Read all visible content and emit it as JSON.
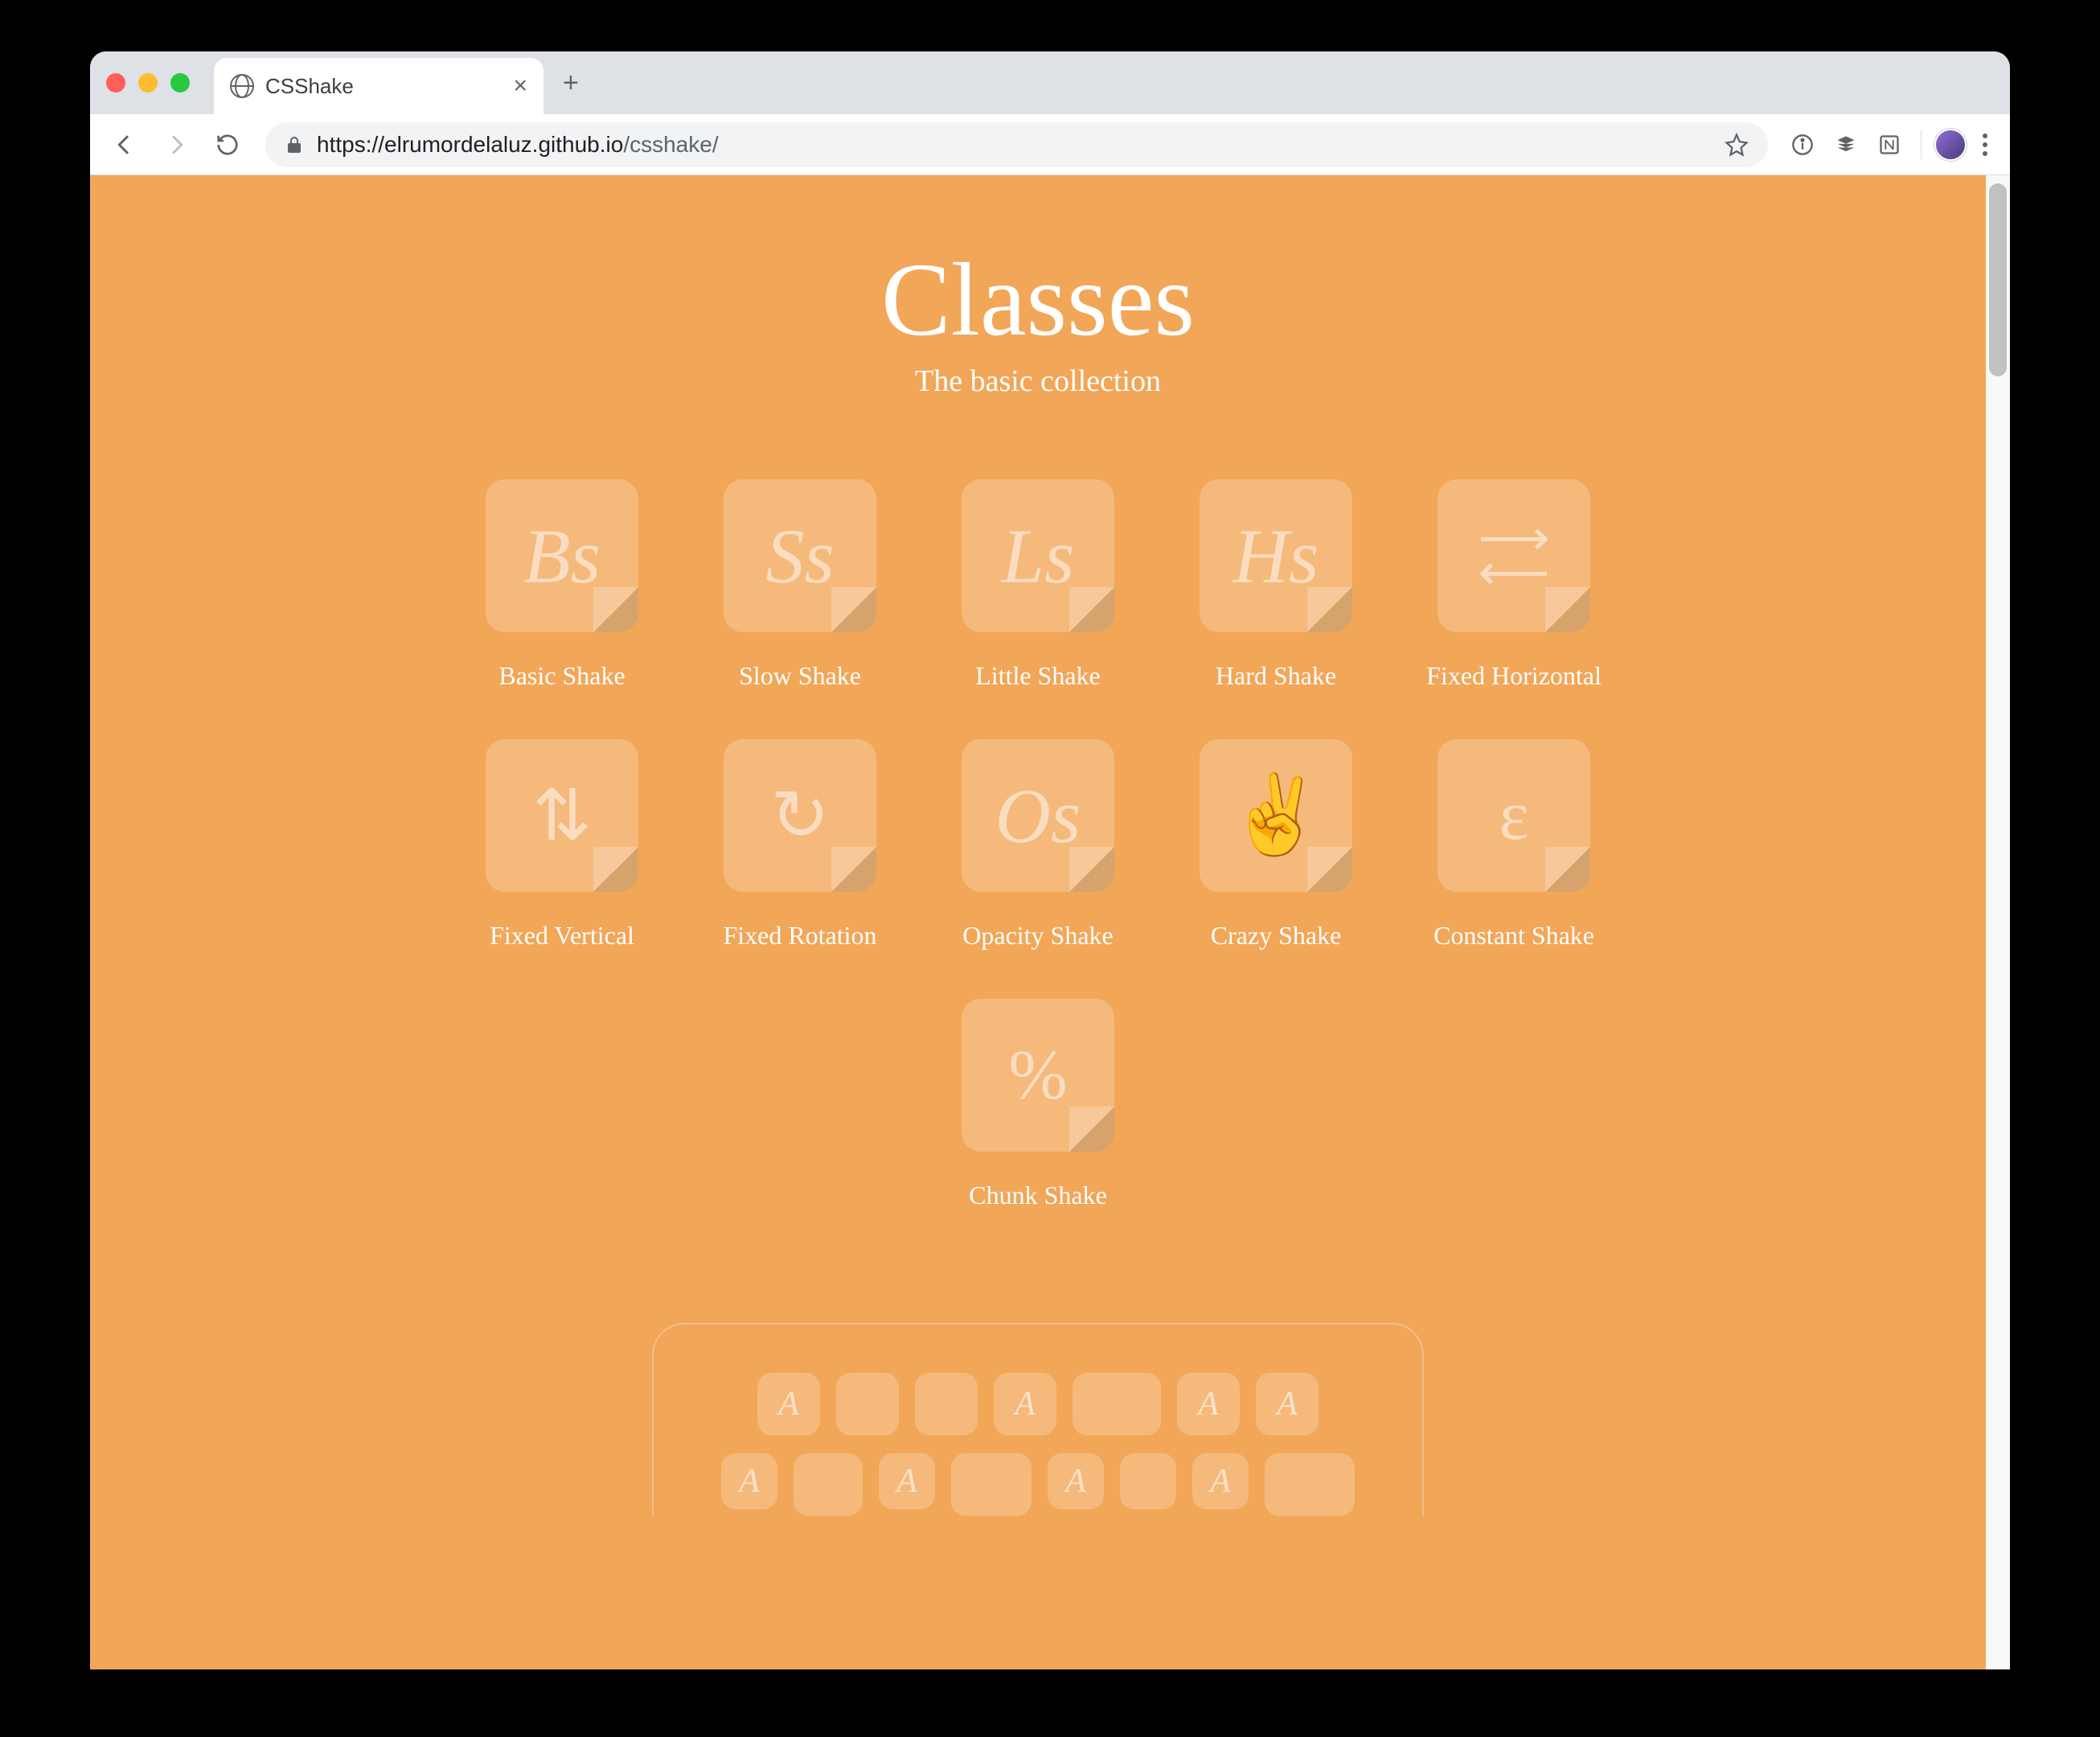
{
  "browser": {
    "tab_title": "CSShake",
    "url_host": "https://elrumordelaluz.github.io",
    "url_path": "/csshake/"
  },
  "page": {
    "title": "Classes",
    "subtitle": "The basic collection",
    "cards": [
      {
        "glyph": "Bs",
        "label": "Basic Shake",
        "kind": "script"
      },
      {
        "glyph": "Ss",
        "label": "Slow Shake",
        "kind": "script"
      },
      {
        "glyph": "Ls",
        "label": "Little Shake",
        "kind": "script"
      },
      {
        "glyph": "Hs",
        "label": "Hard Shake",
        "kind": "script"
      },
      {
        "glyph": "⇄",
        "label": "Fixed Horizontal",
        "kind": "arrows-h"
      },
      {
        "glyph": "⇅",
        "label": "Fixed Vertical",
        "kind": "symbol"
      },
      {
        "glyph": "↻",
        "label": "Fixed Rotation",
        "kind": "symbol"
      },
      {
        "glyph": "Os",
        "label": "Opacity Shake",
        "kind": "script"
      },
      {
        "glyph": "✌️",
        "label": "Crazy Shake",
        "kind": "emoji"
      },
      {
        "glyph": "ε",
        "label": "Constant Shake",
        "kind": "symbol"
      },
      {
        "glyph": "%",
        "label": "Chunk Shake",
        "kind": "symbol"
      }
    ],
    "keyboard": {
      "row1": [
        "A",
        "",
        "",
        "A",
        "",
        "A",
        "A"
      ],
      "row2": [
        "A",
        "",
        "A",
        "",
        "A",
        "",
        "A",
        ""
      ]
    }
  }
}
